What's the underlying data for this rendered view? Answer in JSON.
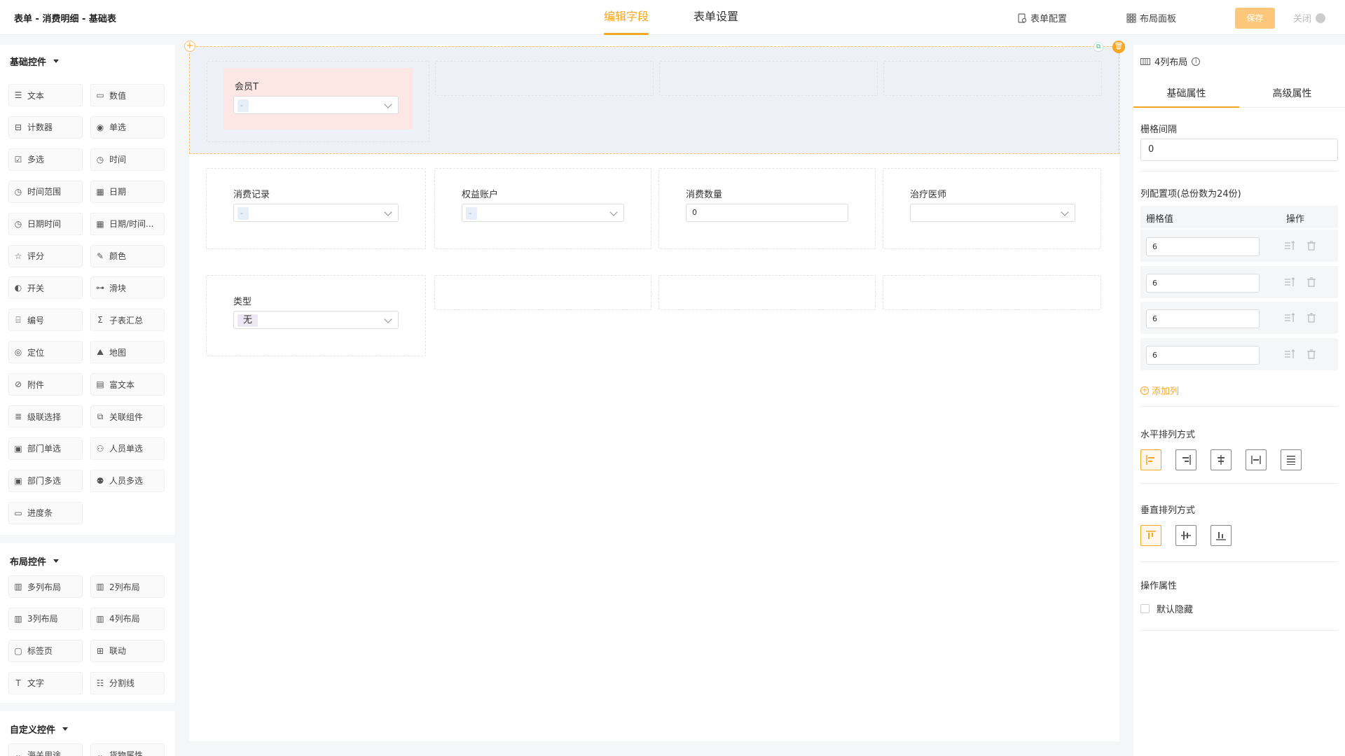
{
  "header": {
    "title": "表单 - 消费明细 - 基础表",
    "tabs": [
      {
        "label": "编辑字段",
        "active": true
      },
      {
        "label": "表单设置",
        "active": false
      }
    ],
    "form_config_label": "表单配置",
    "layout_panel_label": "布局面板",
    "save_label": "保存",
    "close_label": "关闭"
  },
  "left": {
    "sections": [
      {
        "title": "基础控件"
      },
      {
        "title": "布局控件"
      },
      {
        "title": "自定义控件"
      }
    ],
    "basic_controls": [
      {
        "label": "文本",
        "icon": "text-icon"
      },
      {
        "label": "数值",
        "icon": "number-icon"
      },
      {
        "label": "计数器",
        "icon": "counter-icon"
      },
      {
        "label": "单选",
        "icon": "radio-icon"
      },
      {
        "label": "多选",
        "icon": "checkbox-icon"
      },
      {
        "label": "时间",
        "icon": "clock-icon"
      },
      {
        "label": "时间范围",
        "icon": "clock-icon"
      },
      {
        "label": "日期",
        "icon": "calendar-icon"
      },
      {
        "label": "日期时间",
        "icon": "clock-icon"
      },
      {
        "label": "日期/时间...",
        "icon": "calendar-icon"
      },
      {
        "label": "评分",
        "icon": "star-icon"
      },
      {
        "label": "颜色",
        "icon": "dropper-icon"
      },
      {
        "label": "开关",
        "icon": "switch-icon"
      },
      {
        "label": "滑块",
        "icon": "slider-icon"
      },
      {
        "label": "编号",
        "icon": "serial-icon"
      },
      {
        "label": "子表汇总",
        "icon": "sigma-icon"
      },
      {
        "label": "定位",
        "icon": "location-icon"
      },
      {
        "label": "地图",
        "icon": "map-icon"
      },
      {
        "label": "附件",
        "icon": "paperclip-icon"
      },
      {
        "label": "富文本",
        "icon": "richtext-icon"
      },
      {
        "label": "级联选择",
        "icon": "cascade-icon"
      },
      {
        "label": "关联组件",
        "icon": "link-icon"
      },
      {
        "label": "部门单选",
        "icon": "department-icon"
      },
      {
        "label": "人员单选",
        "icon": "user-icon"
      },
      {
        "label": "部门多选",
        "icon": "department-icon"
      },
      {
        "label": "人员多选",
        "icon": "users-icon"
      },
      {
        "label": "进度条",
        "icon": "progress-icon"
      }
    ],
    "layout_controls": [
      {
        "label": "多列布局",
        "icon": "columns-icon"
      },
      {
        "label": "2列布局",
        "icon": "columns-icon"
      },
      {
        "label": "3列布局",
        "icon": "columns-icon"
      },
      {
        "label": "4列布局",
        "icon": "columns-icon"
      },
      {
        "label": "标签页",
        "icon": "tabs-icon"
      },
      {
        "label": "联动",
        "icon": "grid-icon"
      },
      {
        "label": "文字",
        "icon": "text-t-icon"
      },
      {
        "label": "分割线",
        "icon": "divider-icon"
      }
    ],
    "custom_controls": [
      {
        "label": "海关用途",
        "icon": "chevron-down-icon"
      },
      {
        "label": "货物属性",
        "icon": "chevron-down-icon"
      }
    ]
  },
  "canvas": {
    "row1": {
      "field": {
        "label": "会员T",
        "chip": "-"
      }
    },
    "row2": [
      {
        "label": "消费记录",
        "type": "select",
        "chip": "-"
      },
      {
        "label": "权益账户",
        "type": "select",
        "chip": "-"
      },
      {
        "label": "消费数量",
        "type": "input",
        "value": "0"
      },
      {
        "label": "治疗医师",
        "type": "select",
        "chip": ""
      }
    ],
    "row3": {
      "field": {
        "label": "类型",
        "chip": "无"
      }
    }
  },
  "right": {
    "title": "4列布局",
    "tabs": [
      {
        "label": "基础属性",
        "active": true
      },
      {
        "label": "高级属性",
        "active": false
      }
    ],
    "gap_label": "栅格间隔",
    "gap_value": "0",
    "columns_label": "列配置项(总份数为24份)",
    "table_head": {
      "value": "栅格值",
      "action": "操作"
    },
    "columns": [
      "6",
      "6",
      "6",
      "6"
    ],
    "add_column_label": "添加列",
    "h_align_label": "水平排列方式",
    "v_align_label": "垂直排列方式",
    "op_label": "操作属性",
    "default_hidden_label": "默认隐藏",
    "accent_color": "#f5a623"
  }
}
